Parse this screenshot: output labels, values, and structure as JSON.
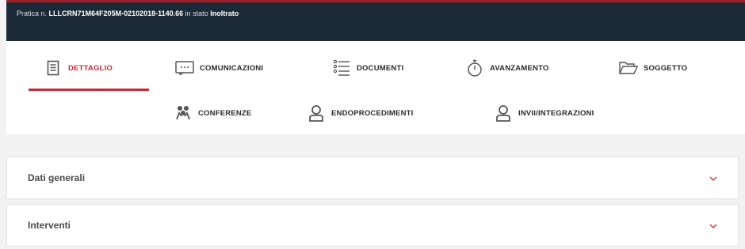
{
  "header": {
    "prefix": "Pratica n.",
    "code": "LLLCRN71M64F205M-02102018-1140.66",
    "middle": "in stato",
    "status": "Inoltrato",
    "background": "#1c2a38",
    "accent": "#a3202a"
  },
  "tabs": [
    {
      "label": "DETTAGLIO",
      "icon": "document-icon",
      "active": true
    },
    {
      "label": "COMUNICAZIONI",
      "icon": "message-icon",
      "active": false
    },
    {
      "label": "DOCUMENTI",
      "icon": "list-icon",
      "active": false
    },
    {
      "label": "AVANZAMENTO",
      "icon": "stopwatch-icon",
      "active": false
    },
    {
      "label": "SOGGETTO",
      "icon": "folder-icon",
      "active": false
    },
    {
      "label": "CONFERENZE",
      "icon": "meeting-icon",
      "active": false
    },
    {
      "label": "ENDOPROCEDIMENTI",
      "icon": "user-icon",
      "active": false
    },
    {
      "label": "INVII/INTEGRAZIONI",
      "icon": "user-icon",
      "active": false
    }
  ],
  "sections": [
    {
      "title": "Dati generali",
      "icon": "chevron-down-icon"
    },
    {
      "title": "Interventi",
      "icon": "chevron-down-icon"
    }
  ],
  "colors": {
    "active_tab": "#c62b3a",
    "chevron": "#d9534f"
  }
}
